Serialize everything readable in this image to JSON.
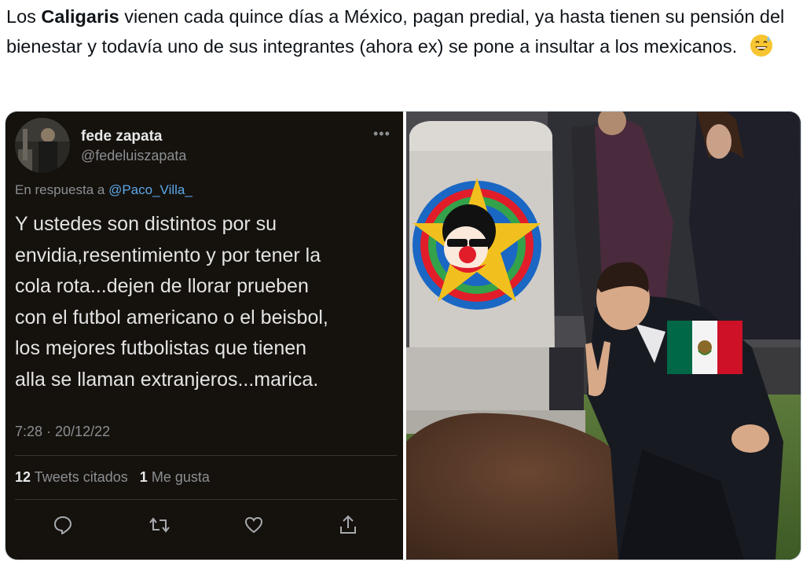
{
  "tweet": {
    "text_pre": "Los ",
    "text_bold": "Caligaris",
    "text_post": " vienen cada quince días a México, pagan predial, ya hasta tienen su pensión del bienestar y todavía uno de sus integrantes (ahora ex) se pone a insultar a los mexicanos.",
    "emoji": "grinning-face-with-sweat-icon"
  },
  "quoted_tweet": {
    "display_name": "fede zapata",
    "handle": "@fedeluiszapata",
    "reply_prefix": "En respuesta a ",
    "reply_to": "@Paco_Villa_",
    "body": "Y ustedes son distintos por su\nenvidia,resentimiento  y por tener la\ncola rota...dejen de llorar prueben\ncon el futbol americano o el beisbol,\nlos mejores futbolistas que tienen\nalla se llaman extranjeros...marica.",
    "timestamp": "7:28 · 20/12/22",
    "quotes_count": "12",
    "quotes_label": "Tweets citados",
    "likes_count": "1",
    "likes_label": "Me gusta",
    "more": "•••"
  },
  "colors": {
    "dark_bg": "#15110c",
    "link": "#5aa8e8",
    "muted": "#8b8f94",
    "flag_green": "#006847",
    "flag_red": "#ce1126"
  }
}
